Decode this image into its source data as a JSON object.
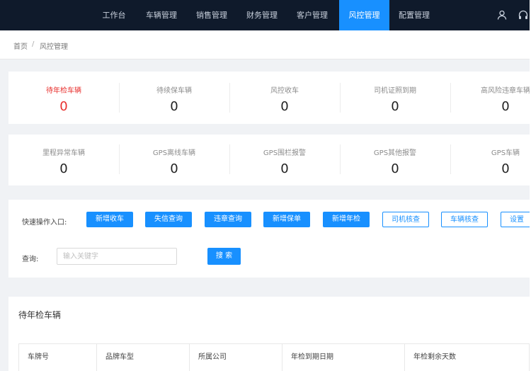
{
  "nav": {
    "items": [
      "工作台",
      "车辆管理",
      "销售管理",
      "财务管理",
      "客户管理",
      "风控管理",
      "配置管理"
    ],
    "active_index": 5,
    "active_color": "#1890ff",
    "background": "#0f1a2b",
    "icons": [
      "user-icon",
      "headset-icon"
    ]
  },
  "breadcrumb": {
    "home": "首页",
    "separator": "/",
    "current": "风控管理"
  },
  "stats_row1": [
    {
      "label": "待年检车辆",
      "value": "0",
      "highlight": true
    },
    {
      "label": "待续保车辆",
      "value": "0"
    },
    {
      "label": "风控收车",
      "value": "0"
    },
    {
      "label": "司机证照到期",
      "value": "0"
    },
    {
      "label": "高风险违章车辆",
      "value": "0"
    }
  ],
  "stats_row2": [
    {
      "label": "里程异常车辆",
      "value": "0"
    },
    {
      "label": "GPS离线车辆",
      "value": "0"
    },
    {
      "label": "GPS围栏报警",
      "value": "0"
    },
    {
      "label": "GPS其他报警",
      "value": "0"
    },
    {
      "label": "GPS车辆",
      "value": "0"
    }
  ],
  "quick_ops": {
    "label": "快速操作入口:",
    "primary_buttons": [
      "新增收车",
      "失信查询",
      "违章查询",
      "新增保单",
      "新增年检"
    ],
    "outline_buttons": [
      "司机核查",
      "车辆核查",
      "设置"
    ]
  },
  "search": {
    "label": "查询:",
    "placeholder": "输入关键字",
    "button": "搜 索"
  },
  "table": {
    "title": "待年检车辆",
    "columns": [
      "车牌号",
      "品牌车型",
      "所属公司",
      "年检到期日期",
      "年检剩余天数"
    ]
  }
}
